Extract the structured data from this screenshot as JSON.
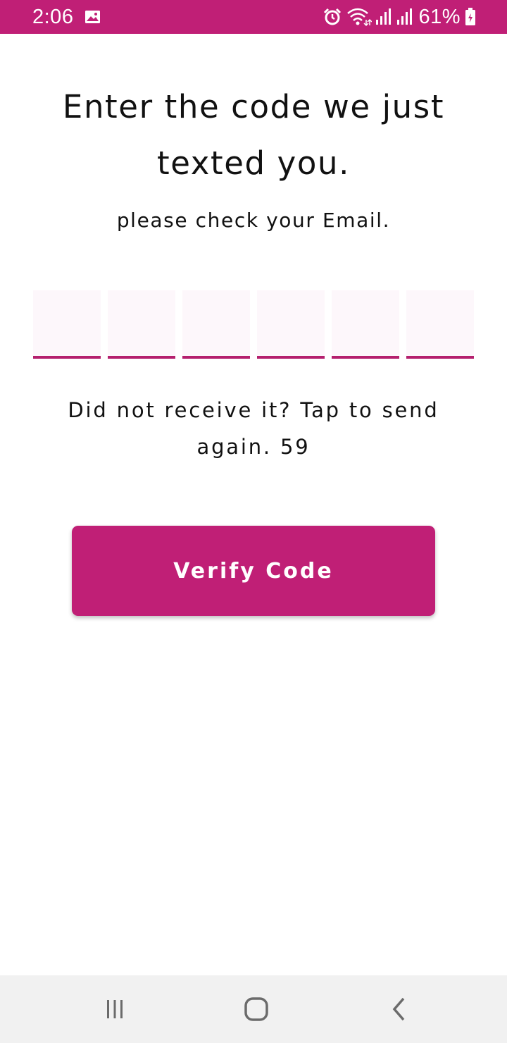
{
  "status_bar": {
    "time": "2:06",
    "battery_percent": "61%",
    "icons": [
      "gallery-icon",
      "alarm-icon",
      "wifi-icon",
      "signal-icon",
      "signal-icon",
      "battery-charging-icon"
    ],
    "background_color": "#c01f76"
  },
  "screen": {
    "title": "Enter the code we just texted you.",
    "subtitle": "please check your Email.",
    "otp": {
      "digit_count": 6,
      "values": [
        "",
        "",
        "",
        "",
        "",
        ""
      ],
      "underline_color": "#b5206e",
      "box_fill": "#fdf7fb"
    },
    "resend_text": "Did not receive it? Tap to send again. 59",
    "verify_button_label": "Verify Code",
    "accent_color": "#c01f76"
  },
  "nav_bar": {
    "icons": [
      "recent-apps-icon",
      "home-icon",
      "back-icon"
    ]
  }
}
